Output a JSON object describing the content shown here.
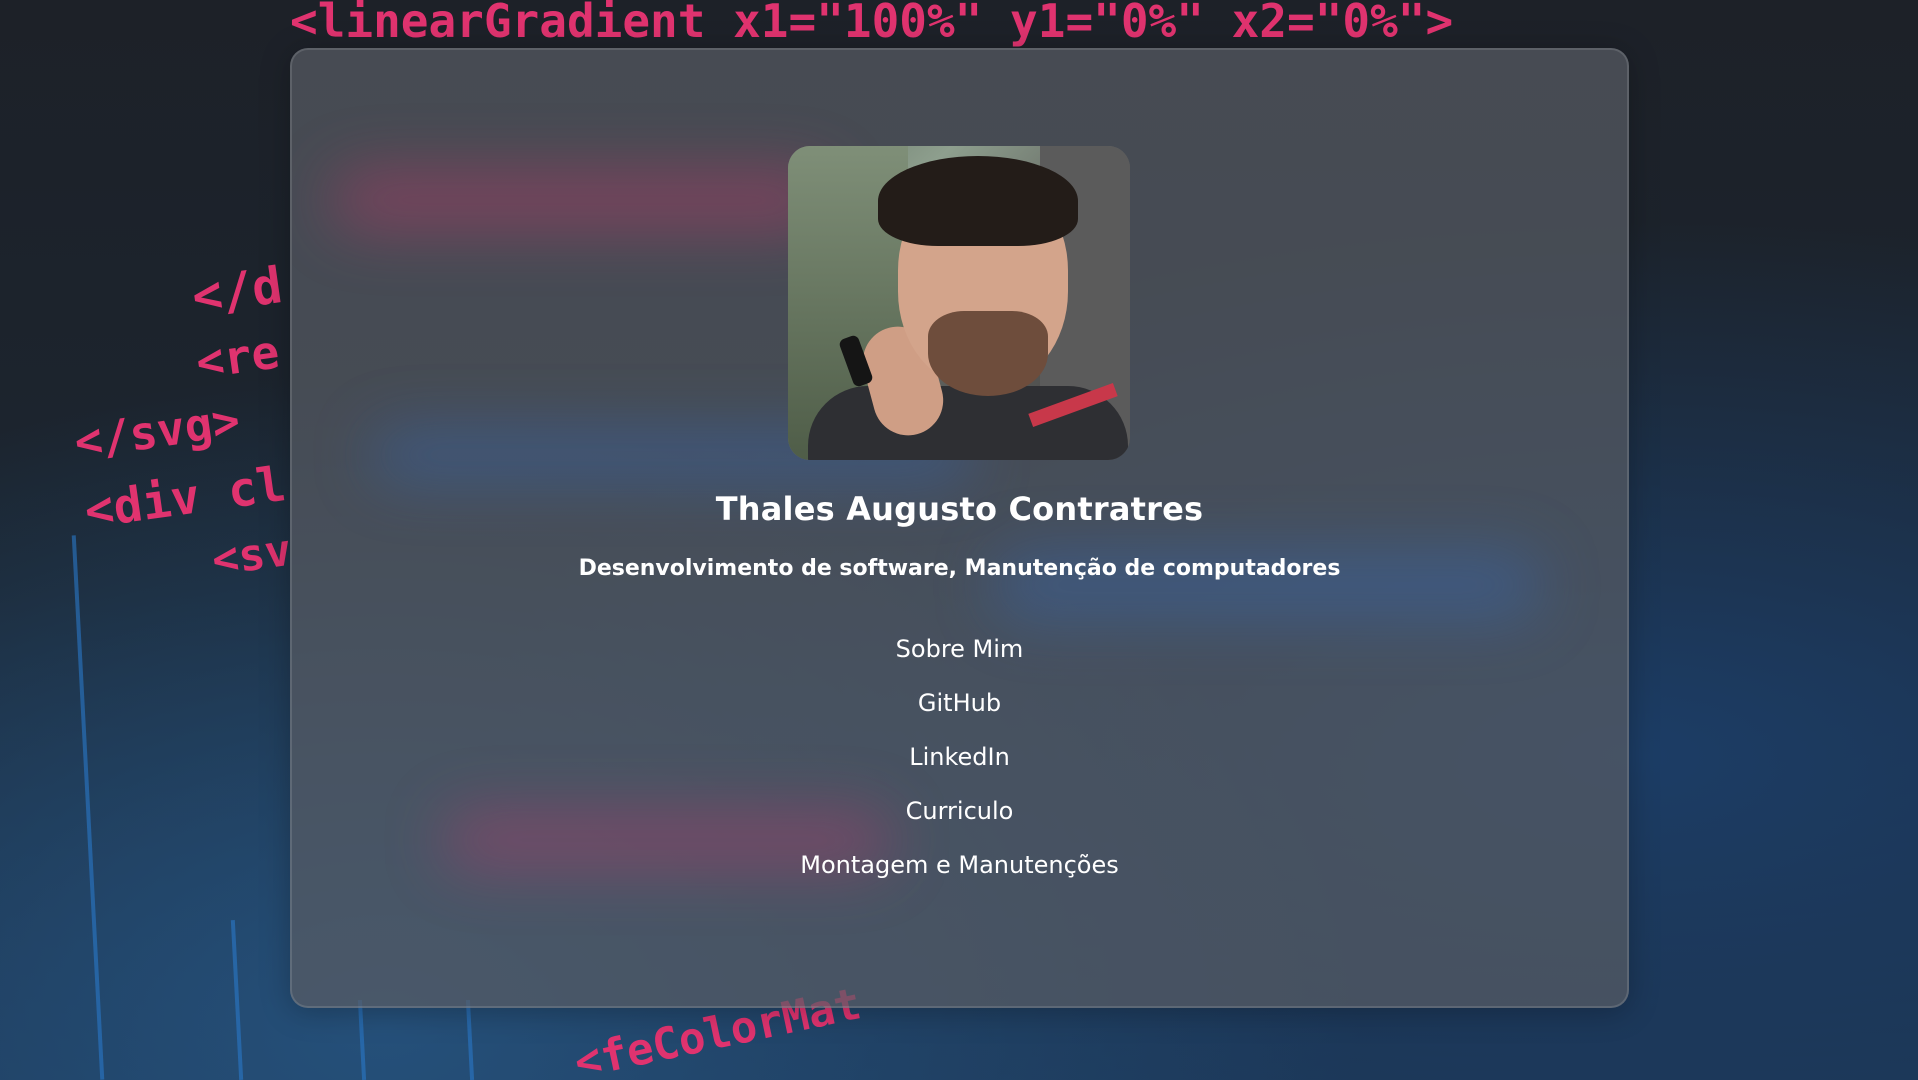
{
  "background": {
    "code_fragments": [
      "<linearGradient x1=\"100%\" y1=\"0%\" x2=\"0%\">",
      "</d",
      "<re",
      "</svg>",
      "<div cl",
      "<sv",
      "<feColorMat"
    ]
  },
  "profile": {
    "photo_alt": "Thales Augusto Contratres",
    "name": "Thales Augusto Contratres",
    "subtitle": "Desenvolvimento de software, Manutenção de computadores"
  },
  "links": [
    {
      "label": "Sobre Mim"
    },
    {
      "label": "GitHub"
    },
    {
      "label": "LinkedIn"
    },
    {
      "label": "Curriculo"
    },
    {
      "label": "Montagem e Manutenções"
    }
  ],
  "colors": {
    "accent_pink": "#e0336f",
    "accent_blue": "#2f6fd1",
    "card_bg": "#585c64",
    "text": "#ffffff"
  }
}
